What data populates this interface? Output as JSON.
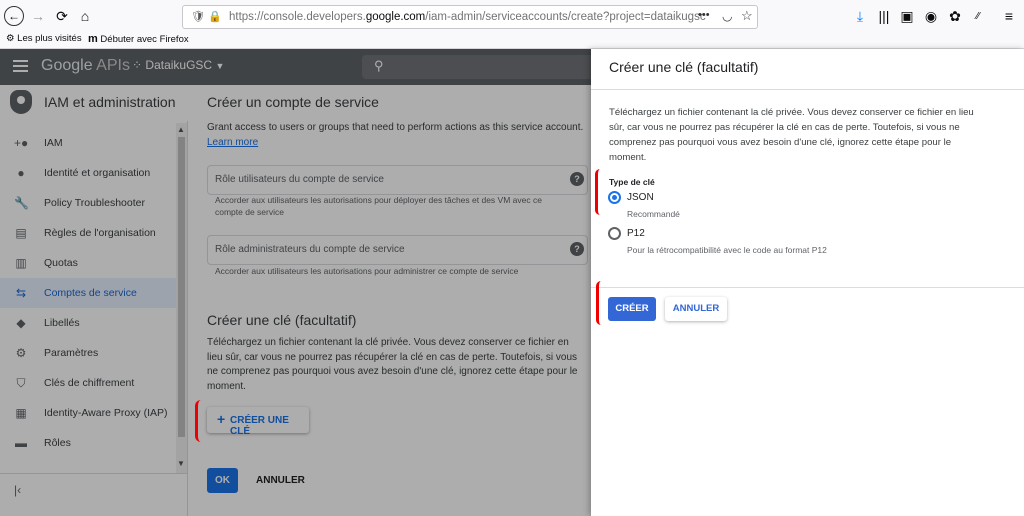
{
  "browser": {
    "url_prefix": "https://console.developers.",
    "url_domain": "google.com",
    "url_suffix": "/iam-admin/serviceaccounts/create?project=dataikugsc",
    "bookmarks": [
      "Les plus visités",
      "Débuter avec Firefox"
    ],
    "more_label": "•••"
  },
  "header": {
    "brand_google": "Google",
    "brand_apis": "APIs",
    "project": "DataikuGSC"
  },
  "sidebar": {
    "title": "IAM et administration",
    "items": [
      {
        "label": "IAM",
        "icon": "person-add-icon"
      },
      {
        "label": "Identité et organisation",
        "icon": "account-circle-icon"
      },
      {
        "label": "Policy Troubleshooter",
        "icon": "wrench-icon"
      },
      {
        "label": "Règles de l'organisation",
        "icon": "document-icon"
      },
      {
        "label": "Quotas",
        "icon": "chart-icon"
      },
      {
        "label": "Comptes de service",
        "icon": "service-account-icon"
      },
      {
        "label": "Libellés",
        "icon": "label-icon"
      },
      {
        "label": "Paramètres",
        "icon": "gear-icon"
      },
      {
        "label": "Clés de chiffrement",
        "icon": "shield-icon"
      },
      {
        "label": "Identity-Aware Proxy (IAP)",
        "icon": "proxy-icon"
      },
      {
        "label": "Rôles",
        "icon": "hat-icon"
      }
    ]
  },
  "main": {
    "title": "Créer un compte de service",
    "intro": "Grant access to users or groups that need to perform actions as this service account.",
    "learn_more": "Learn more",
    "field_users_label": "Rôle utilisateurs du compte de service",
    "field_users_hint": "Accorder aux utilisateurs les autorisations pour déployer des tâches et des VM avec ce compte de service",
    "field_admins_label": "Rôle administrateurs du compte de service",
    "field_admins_hint": "Accorder aux utilisateurs les autorisations pour administrer ce compte de service",
    "key_section_title": "Créer une clé (facultatif)",
    "key_section_text": "Téléchargez un fichier contenant la clé privée. Vous devez conserver ce fichier en lieu sûr, car vous ne pourrez pas récupérer la clé en cas de perte. Toutefois, si vous ne comprenez pas pourquoi vous avez besoin d'une clé, ignorez cette étape pour le moment.",
    "create_key_button": "CRÉER UNE CLÉ",
    "ok_button": "OK",
    "cancel_button": "ANNULER"
  },
  "panel": {
    "title": "Créer une clé (facultatif)",
    "text": "Téléchargez un fichier contenant la clé privée. Vous devez conserver ce fichier en lieu sûr, car vous ne pourrez pas récupérer la clé en cas de perte. Toutefois, si vous ne comprenez pas pourquoi vous avez besoin d'une clé, ignorez cette étape pour le moment.",
    "key_type_label": "Type de clé",
    "options": [
      {
        "label": "JSON",
        "hint": "Recommandé",
        "selected": true
      },
      {
        "label": "P12",
        "hint": "Pour la rétrocompatibilité avec le code au format P12",
        "selected": false
      }
    ],
    "create_button": "CRÉER",
    "cancel_button": "ANNULER"
  },
  "colors": {
    "primary": "#3367d6",
    "annotation": "#ee0000"
  }
}
